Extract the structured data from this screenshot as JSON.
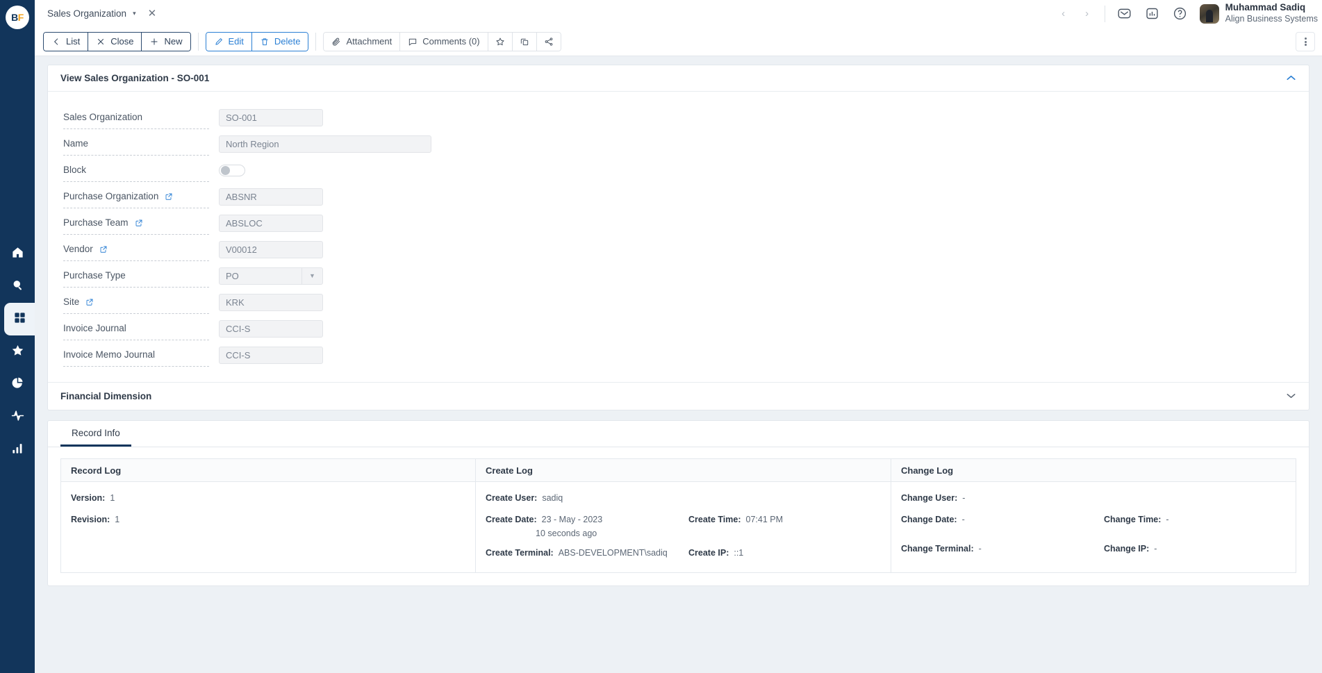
{
  "app": {
    "logo_b": "B",
    "logo_f": "F"
  },
  "rail": {
    "items": [
      {
        "name": "home",
        "icon": "home-icon"
      },
      {
        "name": "search",
        "icon": "search-icon"
      },
      {
        "name": "modules",
        "icon": "grid-icon"
      },
      {
        "name": "favorites",
        "icon": "star-icon"
      },
      {
        "name": "reports",
        "icon": "pie-chart-icon"
      },
      {
        "name": "activity",
        "icon": "activity-icon"
      },
      {
        "name": "analytics",
        "icon": "bar-chart-icon"
      }
    ]
  },
  "tabbar": {
    "tab_label": "Sales Organization",
    "caret": "▾",
    "close": "✕"
  },
  "header": {
    "prev": "‹",
    "next": "›",
    "icons": [
      "mail-icon",
      "report-icon",
      "help-icon"
    ],
    "user_name": "Muhammad Sadiq",
    "user_org": "Align Business Systems"
  },
  "toolbar": {
    "list_label": "List",
    "close_label": "Close",
    "new_label": "New",
    "edit_label": "Edit",
    "delete_label": "Delete",
    "attachment_label": "Attachment",
    "comments_label": "Comments (0)",
    "favorite_icon": "star-icon",
    "duplicate_icon": "copy-icon",
    "share_icon": "share-icon",
    "more_icon": "kebab-menu-icon"
  },
  "detail": {
    "title": "View Sales Organization - SO-001",
    "collapse_icon": "chevron-up-icon",
    "fields": [
      {
        "label": "Sales Organization",
        "value": "SO-001",
        "type": "text",
        "link": false,
        "wide": false
      },
      {
        "label": "Name",
        "value": "North Region",
        "type": "text",
        "link": false,
        "wide": true
      },
      {
        "label": "Block",
        "value": "",
        "type": "toggle",
        "link": false,
        "wide": false
      },
      {
        "label": "Purchase Organization",
        "value": "ABSNR",
        "type": "text",
        "link": true,
        "wide": false
      },
      {
        "label": "Purchase Team",
        "value": "ABSLOC",
        "type": "text",
        "link": true,
        "wide": false
      },
      {
        "label": "Vendor",
        "value": "V00012",
        "type": "text",
        "link": true,
        "wide": false
      },
      {
        "label": "Purchase Type",
        "value": "PO",
        "type": "select",
        "link": false,
        "wide": false
      },
      {
        "label": "Site",
        "value": "KRK",
        "type": "text",
        "link": true,
        "wide": false
      },
      {
        "label": "Invoice Journal",
        "value": "CCI-S",
        "type": "text",
        "link": false,
        "wide": false
      },
      {
        "label": "Invoice Memo Journal",
        "value": "CCI-S",
        "type": "text",
        "link": false,
        "wide": false
      }
    ]
  },
  "financial_dimension": {
    "title": "Financial Dimension",
    "collapse_icon": "chevron-down-icon"
  },
  "record_tabs": {
    "tabs": [
      {
        "label": "Record Info",
        "active": true
      }
    ]
  },
  "record_log": {
    "title": "Record Log",
    "version_key": "Version:",
    "version_value": "1",
    "revision_key": "Revision:",
    "revision_value": "1"
  },
  "create_log": {
    "title": "Create Log",
    "user_key": "Create User:",
    "user_value": "sadiq",
    "date_key": "Create Date:",
    "date_value": "23 - May - 2023",
    "relative_value": "10 seconds ago",
    "time_key": "Create Time:",
    "time_value": "07:41 PM",
    "terminal_key": "Create Terminal:",
    "terminal_value": "ABS-DEVELOPMENT\\sadiq",
    "ip_key": "Create IP:",
    "ip_value": "::1"
  },
  "change_log": {
    "title": "Change Log",
    "user_key": "Change User:",
    "user_value": "-",
    "date_key": "Change Date:",
    "date_value": "-",
    "time_key": "Change Time:",
    "time_value": "-",
    "terminal_key": "Change Terminal:",
    "terminal_value": "-",
    "ip_key": "Change IP:",
    "ip_value": "-"
  },
  "colors": {
    "rail": "#12355b",
    "accent_blue": "#2a7fd4",
    "page_bg": "#edf1f5",
    "logo_gold": "#f5a623"
  }
}
